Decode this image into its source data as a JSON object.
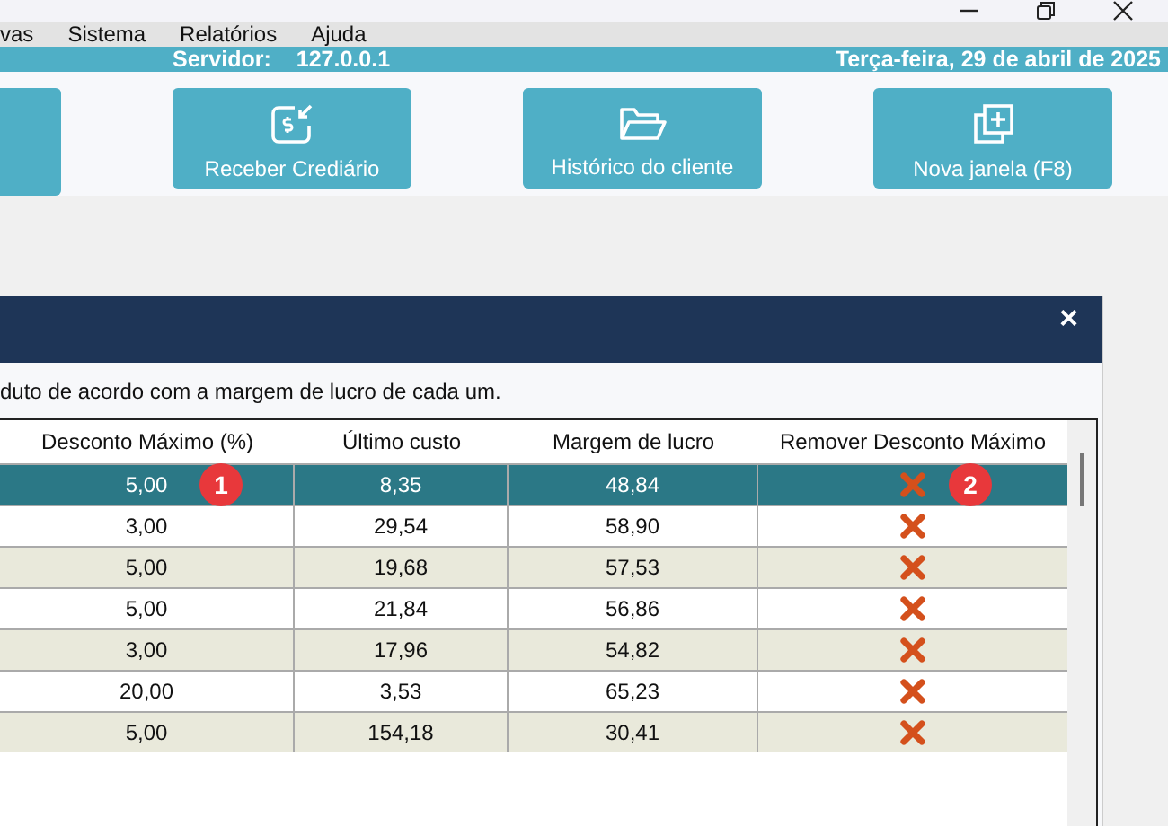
{
  "menu": [
    "vas",
    "Sistema",
    "Relatórios",
    "Ajuda"
  ],
  "status_bar": {
    "server_label": "Servidor:",
    "server": "127.0.0.1",
    "date": "Terça-feira, 29 de abril de 2025"
  },
  "toolbar": [
    {
      "kind": "partial"
    },
    {
      "kind": "credit",
      "label": "Receber Crediário"
    },
    {
      "kind": "folder",
      "label": "Histórico do cliente"
    },
    {
      "kind": "newwindow",
      "label": "Nova janela (F8)"
    }
  ],
  "dialog": {
    "close": "×",
    "description": "duto de acordo com a margem de lucro de cada um.",
    "table": {
      "columns": [
        "Desconto Máximo (%)",
        "Último custo",
        "Margem de lucro",
        "Remover Desconto Máximo"
      ],
      "rows": [
        {
          "cells": [
            "5,00",
            "8,35",
            "48,84"
          ],
          "selected": true
        },
        {
          "cells": [
            "3,00",
            "29,54",
            "58,90"
          ],
          "selected": false
        },
        {
          "cells": [
            "5,00",
            "19,68",
            "57,53"
          ],
          "selected": false
        },
        {
          "cells": [
            "5,00",
            "21,84",
            "56,86"
          ],
          "selected": false
        },
        {
          "cells": [
            "3,00",
            "17,96",
            "54,82"
          ],
          "selected": false
        },
        {
          "cells": [
            "20,00",
            "3,53",
            "65,23"
          ],
          "selected": false
        },
        {
          "cells": [
            "5,00",
            "154,18",
            "30,41"
          ],
          "selected": false
        }
      ]
    },
    "callouts": [
      "1",
      "2"
    ]
  }
}
